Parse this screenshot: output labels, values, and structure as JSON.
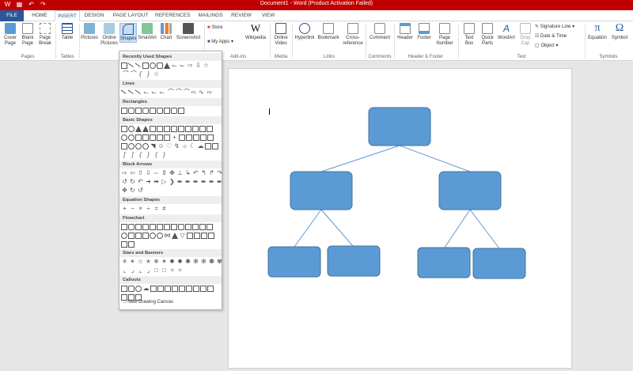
{
  "window": {
    "title": "Document1 - Word (Product Activation Failed)"
  },
  "tabs": [
    {
      "label": "FILE"
    },
    {
      "label": "HOME"
    },
    {
      "label": "INSERT"
    },
    {
      "label": "DESIGN"
    },
    {
      "label": "PAGE LAYOUT"
    },
    {
      "label": "REFERENCES"
    },
    {
      "label": "MAILINGS"
    },
    {
      "label": "REVIEW"
    },
    {
      "label": "VIEW"
    }
  ],
  "ribbon": {
    "pages": {
      "cover": "Cover Page",
      "blank": "Blank Page",
      "break": "Page Break",
      "group": "Pages"
    },
    "tables": {
      "table": "Table",
      "group": "Tables"
    },
    "illustrations": {
      "pictures": "Pictures",
      "online": "Online Pictures",
      "shapes": "Shapes",
      "smartart": "SmartArt",
      "chart": "Chart",
      "screenshot": "Screenshot"
    },
    "addins": {
      "store": "Store",
      "myapps": "My Apps",
      "wikipedia": "Wikipedia",
      "group": "Add-ins"
    },
    "media": {
      "video": "Online Video",
      "group": "Media"
    },
    "links": {
      "hyperlink": "Hyperlink",
      "bookmark": "Bookmark",
      "cross": "Cross-reference",
      "group": "Links"
    },
    "comments": {
      "comment": "Comment",
      "group": "Comments"
    },
    "headerfooter": {
      "header": "Header",
      "footer": "Footer",
      "pagenum": "Page Number",
      "group": "Header & Footer"
    },
    "text": {
      "textbox": "Text Box",
      "quick": "Quick Parts",
      "wordart": "WordArt",
      "dropcap": "Drop Cap",
      "sigline": "Signature Line",
      "datetime": "Date & Time",
      "object": "Object",
      "group": "Text"
    },
    "symbols": {
      "equation": "Equation",
      "symbol": "Symbol",
      "group": "Symbols"
    }
  },
  "shapes_menu": {
    "sections": [
      "Recently Used Shapes",
      "Lines",
      "Rectangles",
      "Basic Shapes",
      "Block Arrows",
      "Equation Shapes",
      "Flowchart",
      "Stars and Banners",
      "Callouts"
    ],
    "new_canvas": "New Drawing Canvas"
  },
  "colors": {
    "accent": "#2b579a",
    "titlebar": "#c00000",
    "box_fill": "#5b9bd5",
    "box_stroke": "#41719c"
  }
}
